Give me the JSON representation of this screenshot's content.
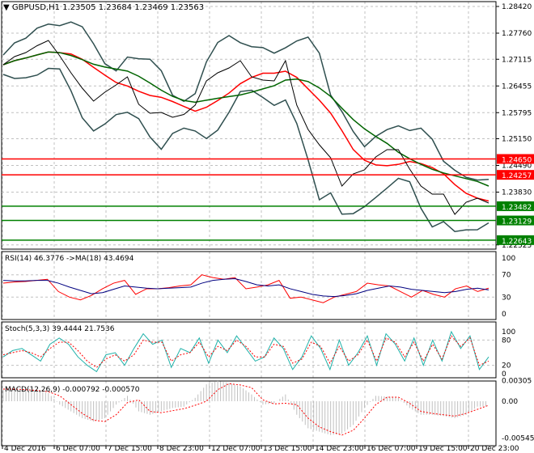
{
  "chart_data": [
    {
      "type": "line",
      "title": "GBPUSD,H1",
      "ohlc": [
        "1.23505",
        "1.23684",
        "1.23469",
        "1.23563"
      ],
      "ylim": [
        1.22525,
        1.2842
      ],
      "yticks": [
        "1.28420",
        "1.27760",
        "1.27115",
        "1.26455",
        "1.25795",
        "1.25150",
        "1.24490",
        "1.23830",
        "1.22525"
      ],
      "close": [
        1.2698,
        1.2718,
        1.2728,
        1.2745,
        1.2758,
        1.272,
        1.2678,
        1.264,
        1.2608,
        1.263,
        1.2648,
        1.2668,
        1.26,
        1.2578,
        1.258,
        1.2568,
        1.2575,
        1.2598,
        1.2658,
        1.2678,
        1.269,
        1.2708,
        1.2668,
        1.266,
        1.2658,
        1.2708,
        1.2598,
        1.2538,
        1.25,
        1.2468,
        1.2398,
        1.2428,
        1.2438,
        1.247,
        1.2488,
        1.2488,
        1.244,
        1.2398,
        1.2378,
        1.2378,
        1.2328,
        1.2358,
        1.2368,
        1.2356
      ],
      "levels": [
        {
          "value": "1.24650",
          "color": "#ff0000"
        },
        {
          "value": "1.24257",
          "color": "#ff0000"
        },
        {
          "value": "1.23482",
          "color": "#008000"
        },
        {
          "value": "1.23129",
          "color": "#008000"
        },
        {
          "value": "1.22643",
          "color": "#008000"
        }
      ]
    },
    {
      "type": "line",
      "title": "RSI(14) 46.3776  ->MA(18) 43.4694",
      "ylim": [
        0,
        100
      ],
      "yticks": [
        "100",
        "70",
        "30",
        "0"
      ],
      "rsi": [
        55,
        57,
        58,
        60,
        62,
        40,
        30,
        25,
        33,
        45,
        55,
        60,
        35,
        45,
        45,
        47,
        50,
        52,
        70,
        65,
        62,
        65,
        45,
        48,
        52,
        60,
        28,
        30,
        25,
        20,
        30,
        35,
        40,
        55,
        52,
        50,
        40,
        30,
        42,
        35,
        30,
        45,
        50,
        40,
        46
      ],
      "ma": [
        60,
        59,
        59,
        60,
        60,
        55,
        48,
        42,
        36,
        38,
        44,
        50,
        48,
        46,
        45,
        46,
        47,
        48,
        55,
        60,
        62,
        63,
        58,
        52,
        50,
        52,
        45,
        40,
        35,
        32,
        31,
        33,
        36,
        42,
        46,
        50,
        48,
        44,
        42,
        40,
        38,
        40,
        44,
        46,
        43
      ]
    },
    {
      "type": "line",
      "title": "Stoch(5,3,3) 39.4444 21.7536",
      "ylim": [
        0,
        100
      ],
      "yticks": [
        "100",
        "80",
        "20",
        "0"
      ],
      "main": [
        40,
        55,
        60,
        45,
        30,
        70,
        85,
        70,
        40,
        20,
        5,
        45,
        50,
        20,
        60,
        95,
        70,
        80,
        15,
        60,
        50,
        85,
        25,
        80,
        50,
        90,
        60,
        30,
        40,
        85,
        60,
        10,
        40,
        90,
        60,
        10,
        80,
        20,
        50,
        90,
        20,
        95,
        70,
        30,
        85,
        20,
        80,
        30,
        100,
        60,
        90,
        10,
        40
      ],
      "signal": [
        45,
        50,
        55,
        50,
        40,
        60,
        75,
        75,
        55,
        30,
        15,
        35,
        45,
        30,
        45,
        80,
        75,
        75,
        30,
        45,
        50,
        75,
        40,
        65,
        55,
        80,
        65,
        40,
        40,
        70,
        65,
        25,
        35,
        75,
        65,
        25,
        65,
        30,
        45,
        80,
        30,
        85,
        75,
        40,
        75,
        30,
        70,
        35,
        90,
        65,
        85,
        20,
        30
      ]
    },
    {
      "type": "bar",
      "title": "MACD(12,26,9) -0.000792 -0.000570",
      "ylim": [
        -0.00545,
        0.00305
      ],
      "yticks": [
        "0.00305",
        "0.00",
        "-0.00545"
      ],
      "hist": [
        0.0017,
        0.0017,
        0.0016,
        0.0015,
        0.0012,
        -0.0005,
        -0.0015,
        -0.0025,
        -0.003,
        -0.0025,
        -0.0005,
        0.0008,
        -0.0015,
        -0.002,
        -0.0015,
        -0.001,
        -0.0008,
        0.0005,
        0.0025,
        0.003,
        0.0027,
        0.0022,
        0.001,
        -0.0005,
        -0.0003,
        0.001,
        -0.002,
        -0.004,
        -0.0045,
        -0.005,
        -0.0048,
        -0.0035,
        -0.001,
        0.0008,
        0.0007,
        0.0005,
        -0.001,
        -0.002,
        -0.002,
        -0.0022,
        -0.0025,
        -0.002,
        -0.0008,
        -0.0008
      ],
      "signal": [
        0.0018,
        0.0018,
        0.0017,
        0.0016,
        0.0014,
        0.0008,
        -0.0005,
        -0.0018,
        -0.0028,
        -0.003,
        -0.002,
        -0.0002,
        0.0002,
        -0.0015,
        -0.0017,
        -0.0014,
        -0.0011,
        -0.0006,
        0.0,
        0.0017,
        0.0026,
        0.0024,
        0.002,
        0.0002,
        -0.0004,
        -0.0003,
        -0.0005,
        -0.0025,
        -0.0038,
        -0.0045,
        -0.005,
        -0.0043,
        -0.0025,
        -0.0005,
        0.0006,
        0.0006,
        -0.0003,
        -0.0015,
        -0.0018,
        -0.002,
        -0.0022,
        -0.0018,
        -0.0012,
        -0.0006
      ]
    }
  ],
  "time_labels": [
    "4 Dec 2016",
    "6 Dec 07:00",
    "7 Dec 15:00",
    "8 Dec 23:00",
    "12 Dec 07:00",
    "13 Dec 15:00",
    "14 Dec 23:00",
    "16 Dec 07:00",
    "19 Dec 15:00",
    "20 Dec 23:00"
  ],
  "header": {
    "symbol": "GBPUSD,H1",
    "values": "1.23505 1.23684 1.23469 1.23563"
  }
}
